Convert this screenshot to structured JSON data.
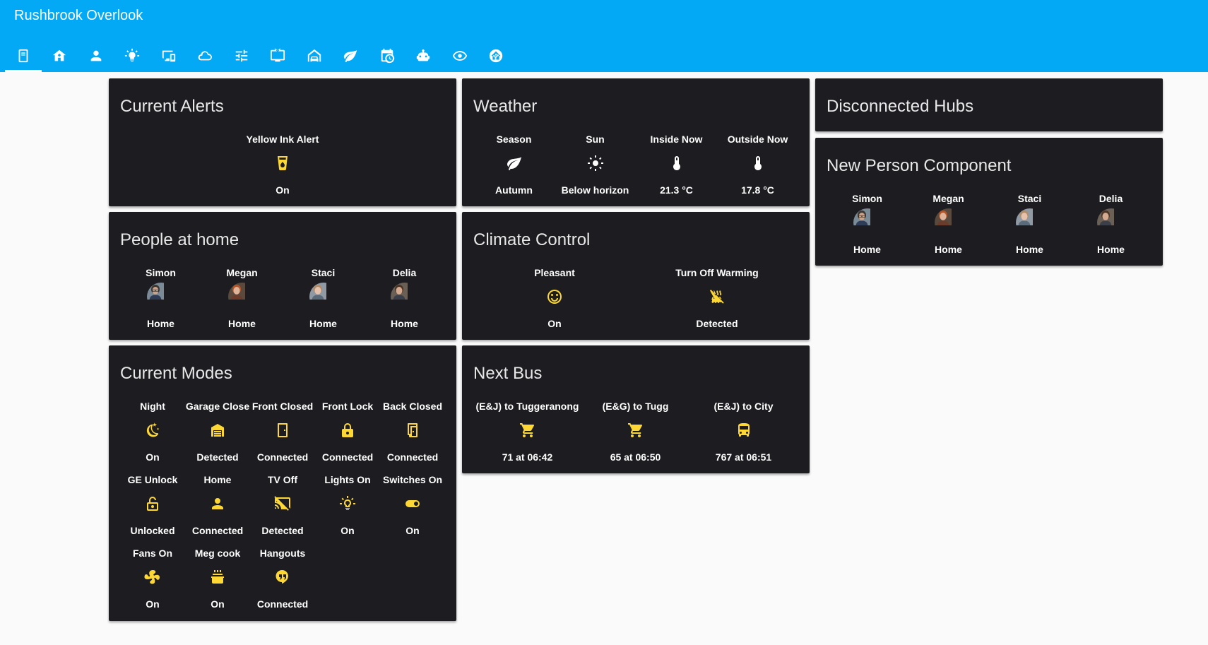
{
  "header": {
    "title": "Rushbrook Overlook",
    "tabs": [
      {
        "icon": "tablet-icon",
        "active": true
      },
      {
        "icon": "home-group-icon"
      },
      {
        "icon": "account-icon"
      },
      {
        "icon": "lightbulb-icon"
      },
      {
        "icon": "monitor-cellphone-icon"
      },
      {
        "icon": "cloud-icon"
      },
      {
        "icon": "tune-icon"
      },
      {
        "icon": "television-icon"
      },
      {
        "icon": "car-home-icon"
      },
      {
        "icon": "leaf-icon"
      },
      {
        "icon": "calendar-clock-icon"
      },
      {
        "icon": "robot-icon"
      },
      {
        "icon": "eye-icon"
      },
      {
        "icon": "home-assistant-icon"
      }
    ]
  },
  "colors": {
    "header": "#03a9f4",
    "card": "#1c1c21",
    "accent": "#fdd835",
    "background": "#fafafa"
  },
  "cards": {
    "alerts": {
      "title": "Current Alerts",
      "badges": [
        {
          "name": "Yellow Ink Alert",
          "icon": "cup-water-icon",
          "state": "On"
        }
      ]
    },
    "weather": {
      "title": "Weather",
      "badges": [
        {
          "name": "Season",
          "icon": "leaf-icon",
          "state": "Autumn"
        },
        {
          "name": "Sun",
          "icon": "sun-icon",
          "state": "Below horizon"
        },
        {
          "name": "Inside Now",
          "icon": "thermometer-icon",
          "state": "21.3 °C"
        },
        {
          "name": "Outside Now",
          "icon": "thermometer-icon",
          "state": "17.8 °C"
        }
      ]
    },
    "hubs": {
      "title": "Disconnected Hubs"
    },
    "person_component": {
      "title": "New Person Component",
      "badges": [
        {
          "name": "Simon",
          "icon": "avatar-simon",
          "state": "Home"
        },
        {
          "name": "Megan",
          "icon": "avatar-megan",
          "state": "Home"
        },
        {
          "name": "Staci",
          "icon": "avatar-staci",
          "state": "Home"
        },
        {
          "name": "Delia",
          "icon": "avatar-delia",
          "state": "Home"
        }
      ]
    },
    "people": {
      "title": "People at home",
      "badges": [
        {
          "name": "Simon",
          "icon": "avatar-simon",
          "state": "Home"
        },
        {
          "name": "Megan",
          "icon": "avatar-megan",
          "state": "Home"
        },
        {
          "name": "Staci",
          "icon": "avatar-staci",
          "state": "Home"
        },
        {
          "name": "Delia",
          "icon": "avatar-delia",
          "state": "Home"
        }
      ]
    },
    "climate": {
      "title": "Climate Control",
      "badges": [
        {
          "name": "Pleasant",
          "icon": "emoticon-happy-icon",
          "state": "On"
        },
        {
          "name": "Turn Off Warming",
          "icon": "radiator-off-icon",
          "state": "Detected"
        }
      ]
    },
    "modes": {
      "title": "Current Modes",
      "badges": [
        {
          "name": "Night",
          "icon": "weather-night-icon",
          "state": "On"
        },
        {
          "name": "Garage Close",
          "icon": "garage-icon",
          "state": "Detected"
        },
        {
          "name": "Front Closed",
          "icon": "door-closed-icon",
          "state": "Connected"
        },
        {
          "name": "Front Lock",
          "icon": "lock-icon",
          "state": "Connected"
        },
        {
          "name": "Back Closed",
          "icon": "door-open-icon",
          "state": "Connected"
        },
        {
          "name": "GE Unlock",
          "icon": "lock-open-icon",
          "state": "Unlocked"
        },
        {
          "name": "Home",
          "icon": "account-icon",
          "state": "Connected"
        },
        {
          "name": "TV Off",
          "icon": "cast-off-icon",
          "state": "Detected"
        },
        {
          "name": "Lights On",
          "icon": "lightbulb-on-icon",
          "state": "On"
        },
        {
          "name": "Switches On",
          "icon": "toggle-switch-icon",
          "state": "On"
        },
        {
          "name": "Fans On",
          "icon": "fan-icon",
          "state": "On"
        },
        {
          "name": "Meg cook",
          "icon": "pot-steam-icon",
          "state": "On"
        },
        {
          "name": "Hangouts",
          "icon": "hangouts-icon",
          "state": "Connected"
        }
      ]
    },
    "bus": {
      "title": "Next Bus",
      "badges": [
        {
          "name": "(E&J) to Tuggeranong",
          "icon": "cart-icon",
          "state": "71 at 06:42"
        },
        {
          "name": "(E&G) to Tugg",
          "icon": "cart-icon",
          "state": "65 at 06:50"
        },
        {
          "name": "(E&J) to City",
          "icon": "bus-icon",
          "state": "767 at 06:51"
        }
      ]
    }
  }
}
